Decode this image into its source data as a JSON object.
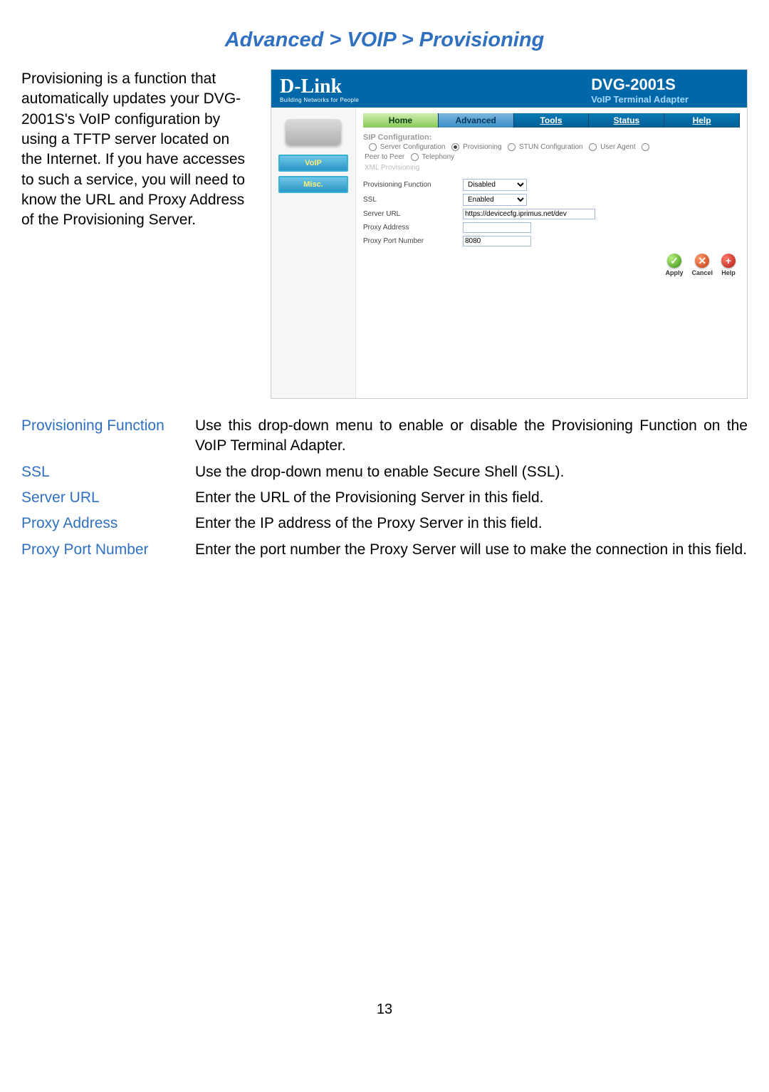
{
  "title": "Advanced > VOIP > Provisioning",
  "intro": "Provisioning is a function that automatically updates your DVG-2001S's VoIP configuration by using a TFTP server located on the Internet. If you have accesses to such a service, you will need to know the URL and Proxy Address of the Provisioning Server.",
  "screenshot": {
    "logo": "D-Link",
    "logo_sub": "Building Networks for People",
    "product": "DVG-2001S",
    "tagline": "VoIP Terminal Adapter",
    "tabs": {
      "home": "Home",
      "advanced": "Advanced",
      "tools": "Tools",
      "status": "Status",
      "help": "Help"
    },
    "side": {
      "voip": "VoIP",
      "misc": "Misc."
    },
    "sip_heading": "SIP Configuration:",
    "sip_opts": {
      "server_cfg": "Server Configuration",
      "provisioning": "Provisioning",
      "stun": "STUN Configuration",
      "user_agent": "User Agent",
      "peer": "Peer to Peer",
      "telephony": "Telephony"
    },
    "xml": "XML Provisioning",
    "form": {
      "prov_label": "Provisioning Function",
      "prov_value": "Disabled",
      "ssl_label": "SSL",
      "ssl_value": "Enabled",
      "url_label": "Server URL",
      "url_value": "https://devicecfg.iprimus.net/dev",
      "proxy_addr_label": "Proxy Address",
      "proxy_addr_value": "",
      "proxy_port_label": "Proxy Port Number",
      "proxy_port_value": "8080"
    },
    "actions": {
      "apply": "Apply",
      "cancel": "Cancel",
      "help": "Help"
    }
  },
  "definitions": [
    {
      "term": "Provisioning Function",
      "desc": "Use this drop-down menu to enable or disable the Provisioning Function on the VoIP Terminal Adapter."
    },
    {
      "term": "SSL",
      "desc": "Use the drop-down menu to enable Secure Shell (SSL)."
    },
    {
      "term": "Server URL",
      "desc": "Enter the URL of the Provisioning Server in this field."
    },
    {
      "term": "Proxy Address",
      "desc": "Enter the IP address of the Proxy Server in this field."
    },
    {
      "term": "Proxy Port Number",
      "desc": "Enter the port number the Proxy Server will use to make the connection in this field."
    }
  ],
  "page_number": "13"
}
